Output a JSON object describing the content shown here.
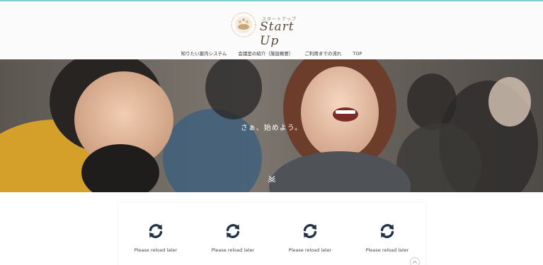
{
  "header": {
    "logo_small": "スタートアップ",
    "logo_main": "Start Up"
  },
  "nav": [
    {
      "label": "知りたい案内システム"
    },
    {
      "label": "会議室の紹介（施設概要）"
    },
    {
      "label": "ご利用までの流れ"
    },
    {
      "label": "TOP"
    }
  ],
  "hero": {
    "headline": "さぁ、始めよう。",
    "scroll_label": "Scroll"
  },
  "tiles": [
    {
      "icon": "reload-icon",
      "label": "Please reload later"
    },
    {
      "icon": "reload-icon",
      "label": "Please reload later"
    },
    {
      "icon": "reload-icon",
      "label": "Please reload later"
    },
    {
      "icon": "reload-icon",
      "label": "Please reload later"
    }
  ],
  "colors": {
    "accent": "#7fcfcf",
    "icon": "#1f3346",
    "header_bg": "#fbfbfb"
  }
}
